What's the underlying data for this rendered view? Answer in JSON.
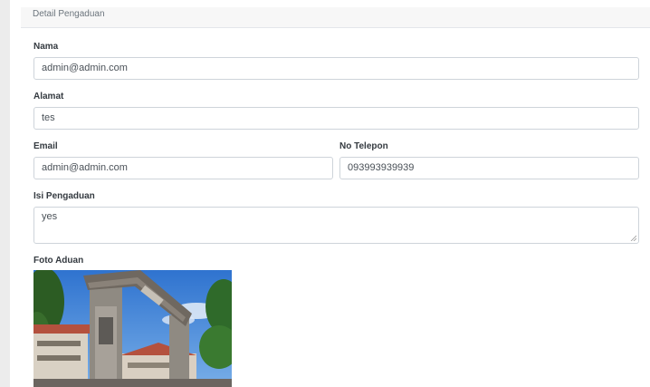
{
  "header": {
    "title": "Detail Pengaduan"
  },
  "form": {
    "nama": {
      "label": "Nama",
      "value": "admin@admin.com"
    },
    "alamat": {
      "label": "Alamat",
      "value": "tes"
    },
    "email": {
      "label": "Email",
      "value": "admin@admin.com"
    },
    "no_telepon": {
      "label": "No Telepon",
      "value": "093993939939"
    },
    "isi_pengaduan": {
      "label": "Isi Pengaduan",
      "value": "yes"
    },
    "foto_aduan": {
      "label": "Foto Aduan"
    }
  },
  "colors": {
    "border": "#ced4da",
    "header_bg": "#f7f7f7",
    "sky": "#3f84d6",
    "tree": "#2f6a2a",
    "roof": "#b4513e"
  }
}
